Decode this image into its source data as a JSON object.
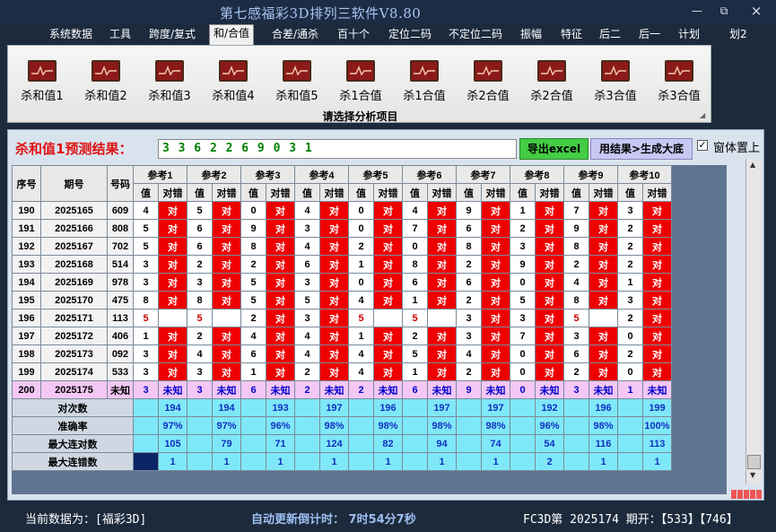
{
  "app": {
    "title": "第七感福彩3D排列三软件V8.80",
    "win_min": "—",
    "win_max": "⧉",
    "win_close": "×"
  },
  "menu": [
    "系统数据",
    "工具",
    "跨度/复式",
    "和/合值",
    "合差/通杀",
    "百十个",
    "定位二码",
    "不定位二码",
    "振幅",
    "特征",
    "后二",
    "后一",
    "计划",
    "划2"
  ],
  "menu_active_index": 3,
  "ribbon": {
    "buttons": [
      "杀和值1",
      "杀和值2",
      "杀和值3",
      "杀和值4",
      "杀和值5",
      "杀1合值",
      "杀1合值",
      "杀2合值",
      "杀2合值",
      "杀3合值",
      "杀3合值"
    ],
    "icon": "chart-icon",
    "caption": "请选择分析项目"
  },
  "panel": {
    "title": "杀和值1预测结果：",
    "numbers": "3 3 6 2 2 6 9 0 3 1",
    "excel_button": "导出excel",
    "generate_button": "用结果>生成大底",
    "pin_checked": true,
    "pin_mark": "✓",
    "pin_label": "窗体置上"
  },
  "table": {
    "head_seq": "序号",
    "head_period": "期号",
    "head_code": "号码",
    "ref_groups": [
      "参考1",
      "参考2",
      "参考3",
      "参考4",
      "参考5",
      "参考6",
      "参考7",
      "参考8",
      "参考9",
      "参考10"
    ],
    "sub_val": "值",
    "sub_judge": "对错",
    "right_mark": "对",
    "unknown_mark": "未知",
    "rows": [
      {
        "seq": "190",
        "period": "2025165",
        "code": "609",
        "vals": [
          "4",
          "5",
          "0",
          "4",
          "0",
          "4",
          "9",
          "1",
          "7",
          "3"
        ],
        "ok": [
          true,
          true,
          true,
          true,
          true,
          true,
          true,
          true,
          true,
          true
        ]
      },
      {
        "seq": "191",
        "period": "2025166",
        "code": "808",
        "vals": [
          "5",
          "6",
          "9",
          "3",
          "0",
          "7",
          "6",
          "2",
          "9",
          "2"
        ],
        "ok": [
          true,
          true,
          true,
          true,
          true,
          true,
          true,
          true,
          true,
          true
        ]
      },
      {
        "seq": "192",
        "period": "2025167",
        "code": "702",
        "vals": [
          "5",
          "6",
          "8",
          "4",
          "2",
          "0",
          "8",
          "3",
          "8",
          "2"
        ],
        "ok": [
          true,
          true,
          true,
          true,
          true,
          true,
          true,
          true,
          true,
          true
        ]
      },
      {
        "seq": "193",
        "period": "2025168",
        "code": "514",
        "vals": [
          "3",
          "2",
          "2",
          "6",
          "1",
          "8",
          "2",
          "9",
          "2",
          "2"
        ],
        "ok": [
          true,
          true,
          true,
          true,
          true,
          true,
          true,
          true,
          true,
          true
        ]
      },
      {
        "seq": "194",
        "period": "2025169",
        "code": "978",
        "vals": [
          "3",
          "3",
          "5",
          "3",
          "0",
          "6",
          "6",
          "0",
          "4",
          "1"
        ],
        "ok": [
          true,
          true,
          true,
          true,
          true,
          true,
          true,
          true,
          true,
          true
        ]
      },
      {
        "seq": "195",
        "period": "2025170",
        "code": "475",
        "vals": [
          "8",
          "8",
          "5",
          "5",
          "4",
          "1",
          "2",
          "5",
          "8",
          "3"
        ],
        "ok": [
          true,
          true,
          true,
          true,
          true,
          true,
          true,
          true,
          true,
          true
        ]
      },
      {
        "seq": "196",
        "period": "2025171",
        "code": "113",
        "vals": [
          "5",
          "5",
          "2",
          "3",
          "5",
          "5",
          "3",
          "3",
          "5",
          "2"
        ],
        "ok": [
          false,
          false,
          true,
          true,
          false,
          false,
          true,
          true,
          false,
          true
        ]
      },
      {
        "seq": "197",
        "period": "2025172",
        "code": "406",
        "vals": [
          "1",
          "2",
          "4",
          "4",
          "1",
          "2",
          "3",
          "7",
          "3",
          "0"
        ],
        "ok": [
          true,
          true,
          true,
          true,
          true,
          true,
          true,
          true,
          true,
          true
        ]
      },
      {
        "seq": "198",
        "period": "2025173",
        "code": "092",
        "vals": [
          "3",
          "4",
          "6",
          "4",
          "4",
          "5",
          "4",
          "0",
          "6",
          "2"
        ],
        "ok": [
          true,
          true,
          true,
          true,
          true,
          true,
          true,
          true,
          true,
          true
        ]
      },
      {
        "seq": "199",
        "period": "2025174",
        "code": "533",
        "vals": [
          "3",
          "3",
          "1",
          "2",
          "4",
          "1",
          "2",
          "0",
          "2",
          "0"
        ],
        "ok": [
          true,
          true,
          true,
          true,
          true,
          true,
          true,
          true,
          true,
          true
        ]
      },
      {
        "seq": "200",
        "period": "2025175",
        "code": "未知",
        "vals": [
          "3",
          "3",
          "6",
          "2",
          "2",
          "6",
          "9",
          "0",
          "3",
          "1"
        ],
        "ok": null
      }
    ],
    "stats": [
      {
        "label": "对次数",
        "values": [
          "194",
          "194",
          "193",
          "197",
          "196",
          "197",
          "197",
          "192",
          "196",
          "199"
        ]
      },
      {
        "label": "准确率",
        "values": [
          "97%",
          "97%",
          "96%",
          "98%",
          "98%",
          "98%",
          "98%",
          "96%",
          "98%",
          "100%"
        ]
      },
      {
        "label": "最大连对数",
        "values": [
          "105",
          "79",
          "71",
          "124",
          "82",
          "94",
          "74",
          "54",
          "116",
          "113"
        ]
      },
      {
        "label": "最大连错数",
        "values": [
          "1",
          "1",
          "1",
          "1",
          "1",
          "1",
          "1",
          "2",
          "1",
          "1"
        ]
      }
    ]
  },
  "status": {
    "data_source": "当前数据为：[福彩3D]",
    "countdown": "自动更新倒计时：  7时54分7秒",
    "issue": "FC3D第 2025174 期开：【533】【746】"
  }
}
